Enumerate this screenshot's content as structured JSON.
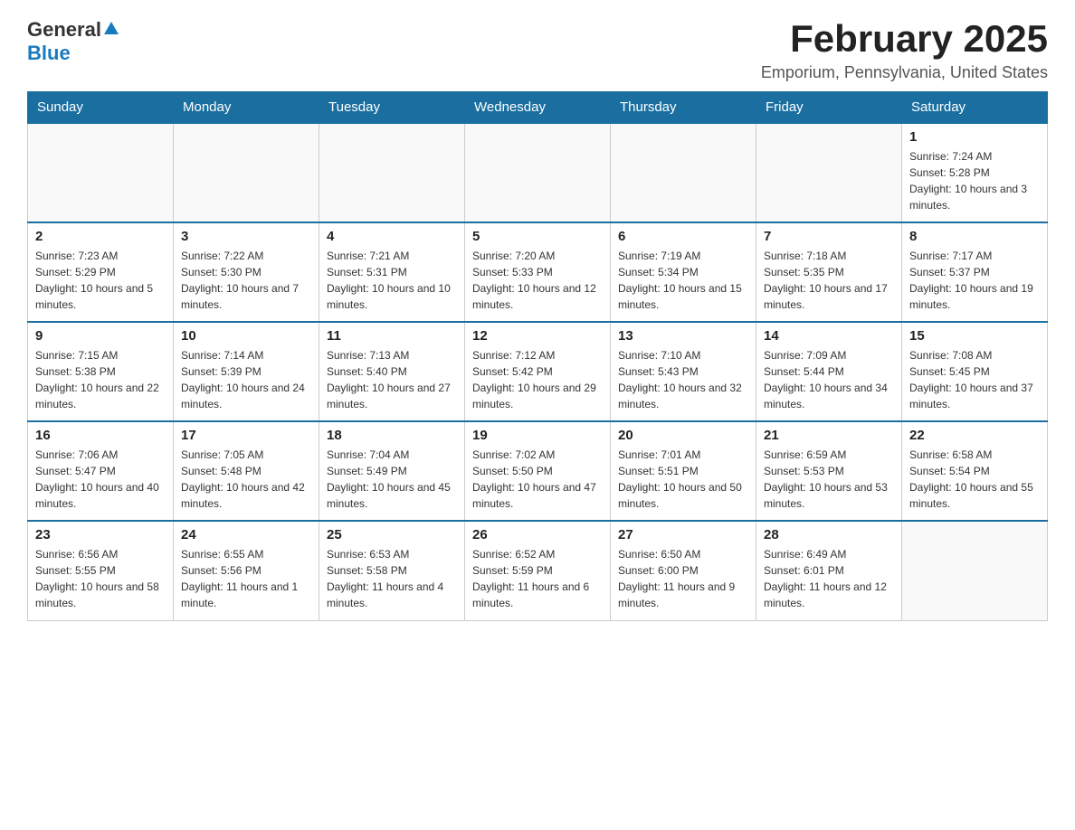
{
  "header": {
    "logo_general": "General",
    "logo_blue": "Blue",
    "month_title": "February 2025",
    "location": "Emporium, Pennsylvania, United States"
  },
  "weekdays": [
    "Sunday",
    "Monday",
    "Tuesday",
    "Wednesday",
    "Thursday",
    "Friday",
    "Saturday"
  ],
  "weeks": [
    [
      {
        "day": "",
        "info": ""
      },
      {
        "day": "",
        "info": ""
      },
      {
        "day": "",
        "info": ""
      },
      {
        "day": "",
        "info": ""
      },
      {
        "day": "",
        "info": ""
      },
      {
        "day": "",
        "info": ""
      },
      {
        "day": "1",
        "info": "Sunrise: 7:24 AM\nSunset: 5:28 PM\nDaylight: 10 hours and 3 minutes."
      }
    ],
    [
      {
        "day": "2",
        "info": "Sunrise: 7:23 AM\nSunset: 5:29 PM\nDaylight: 10 hours and 5 minutes."
      },
      {
        "day": "3",
        "info": "Sunrise: 7:22 AM\nSunset: 5:30 PM\nDaylight: 10 hours and 7 minutes."
      },
      {
        "day": "4",
        "info": "Sunrise: 7:21 AM\nSunset: 5:31 PM\nDaylight: 10 hours and 10 minutes."
      },
      {
        "day": "5",
        "info": "Sunrise: 7:20 AM\nSunset: 5:33 PM\nDaylight: 10 hours and 12 minutes."
      },
      {
        "day": "6",
        "info": "Sunrise: 7:19 AM\nSunset: 5:34 PM\nDaylight: 10 hours and 15 minutes."
      },
      {
        "day": "7",
        "info": "Sunrise: 7:18 AM\nSunset: 5:35 PM\nDaylight: 10 hours and 17 minutes."
      },
      {
        "day": "8",
        "info": "Sunrise: 7:17 AM\nSunset: 5:37 PM\nDaylight: 10 hours and 19 minutes."
      }
    ],
    [
      {
        "day": "9",
        "info": "Sunrise: 7:15 AM\nSunset: 5:38 PM\nDaylight: 10 hours and 22 minutes."
      },
      {
        "day": "10",
        "info": "Sunrise: 7:14 AM\nSunset: 5:39 PM\nDaylight: 10 hours and 24 minutes."
      },
      {
        "day": "11",
        "info": "Sunrise: 7:13 AM\nSunset: 5:40 PM\nDaylight: 10 hours and 27 minutes."
      },
      {
        "day": "12",
        "info": "Sunrise: 7:12 AM\nSunset: 5:42 PM\nDaylight: 10 hours and 29 minutes."
      },
      {
        "day": "13",
        "info": "Sunrise: 7:10 AM\nSunset: 5:43 PM\nDaylight: 10 hours and 32 minutes."
      },
      {
        "day": "14",
        "info": "Sunrise: 7:09 AM\nSunset: 5:44 PM\nDaylight: 10 hours and 34 minutes."
      },
      {
        "day": "15",
        "info": "Sunrise: 7:08 AM\nSunset: 5:45 PM\nDaylight: 10 hours and 37 minutes."
      }
    ],
    [
      {
        "day": "16",
        "info": "Sunrise: 7:06 AM\nSunset: 5:47 PM\nDaylight: 10 hours and 40 minutes."
      },
      {
        "day": "17",
        "info": "Sunrise: 7:05 AM\nSunset: 5:48 PM\nDaylight: 10 hours and 42 minutes."
      },
      {
        "day": "18",
        "info": "Sunrise: 7:04 AM\nSunset: 5:49 PM\nDaylight: 10 hours and 45 minutes."
      },
      {
        "day": "19",
        "info": "Sunrise: 7:02 AM\nSunset: 5:50 PM\nDaylight: 10 hours and 47 minutes."
      },
      {
        "day": "20",
        "info": "Sunrise: 7:01 AM\nSunset: 5:51 PM\nDaylight: 10 hours and 50 minutes."
      },
      {
        "day": "21",
        "info": "Sunrise: 6:59 AM\nSunset: 5:53 PM\nDaylight: 10 hours and 53 minutes."
      },
      {
        "day": "22",
        "info": "Sunrise: 6:58 AM\nSunset: 5:54 PM\nDaylight: 10 hours and 55 minutes."
      }
    ],
    [
      {
        "day": "23",
        "info": "Sunrise: 6:56 AM\nSunset: 5:55 PM\nDaylight: 10 hours and 58 minutes."
      },
      {
        "day": "24",
        "info": "Sunrise: 6:55 AM\nSunset: 5:56 PM\nDaylight: 11 hours and 1 minute."
      },
      {
        "day": "25",
        "info": "Sunrise: 6:53 AM\nSunset: 5:58 PM\nDaylight: 11 hours and 4 minutes."
      },
      {
        "day": "26",
        "info": "Sunrise: 6:52 AM\nSunset: 5:59 PM\nDaylight: 11 hours and 6 minutes."
      },
      {
        "day": "27",
        "info": "Sunrise: 6:50 AM\nSunset: 6:00 PM\nDaylight: 11 hours and 9 minutes."
      },
      {
        "day": "28",
        "info": "Sunrise: 6:49 AM\nSunset: 6:01 PM\nDaylight: 11 hours and 12 minutes."
      },
      {
        "day": "",
        "info": ""
      }
    ]
  ]
}
